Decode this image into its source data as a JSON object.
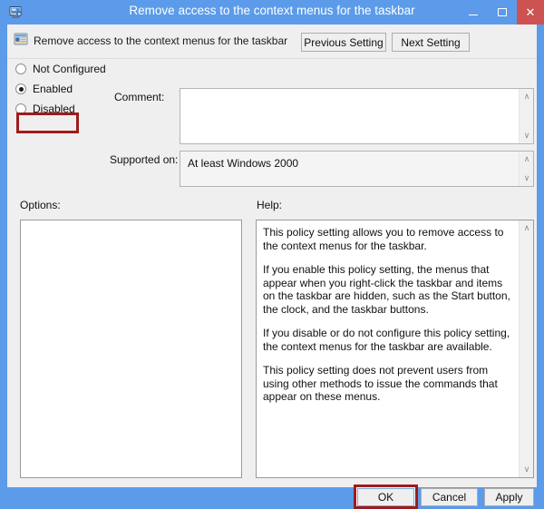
{
  "window": {
    "title": "Remove access to the context menus for the taskbar",
    "icon": "gpedit-monitor-icon",
    "controls": {
      "minimize": "minimize-icon",
      "maximize": "maximize-icon",
      "close": "close-icon",
      "close_glyph": "✕"
    },
    "frame_color": "#5b9bea",
    "close_button_color": "#cd5252"
  },
  "header": {
    "icon": "policy-setting-icon",
    "title": "Remove access to the context menus for the taskbar",
    "previous_setting_label": "Previous Setting",
    "next_setting_label": "Next Setting"
  },
  "settings": {
    "options": [
      {
        "label": "Not Configured",
        "selected": false
      },
      {
        "label": "Enabled",
        "selected": true
      },
      {
        "label": "Disabled",
        "selected": false
      }
    ],
    "comment_label": "Comment:",
    "comment_value": "",
    "supported_on_label": "Supported on:",
    "supported_on_value": "At least Windows 2000"
  },
  "panels": {
    "options_label": "Options:",
    "options_content": "",
    "help_label": "Help:",
    "help_paragraphs": [
      "This policy setting allows you to remove access to the context menus for the taskbar.",
      "If you enable this policy setting, the menus that appear when you right-click the taskbar and items on the taskbar are hidden, such as the Start button, the clock, and the taskbar buttons.",
      "If you disable or do not configure this policy setting, the context menus for the taskbar are available.",
      "This policy setting does not prevent users from using other methods to issue the commands that appear on these menus."
    ]
  },
  "footer": {
    "ok_label": "OK",
    "cancel_label": "Cancel",
    "apply_label": "Apply"
  },
  "annotations": {
    "color": "#9e1b1b",
    "targets": [
      "Enabled",
      "OK"
    ]
  },
  "scrollbars": {
    "up_glyph": "∧",
    "down_glyph": "∨"
  }
}
